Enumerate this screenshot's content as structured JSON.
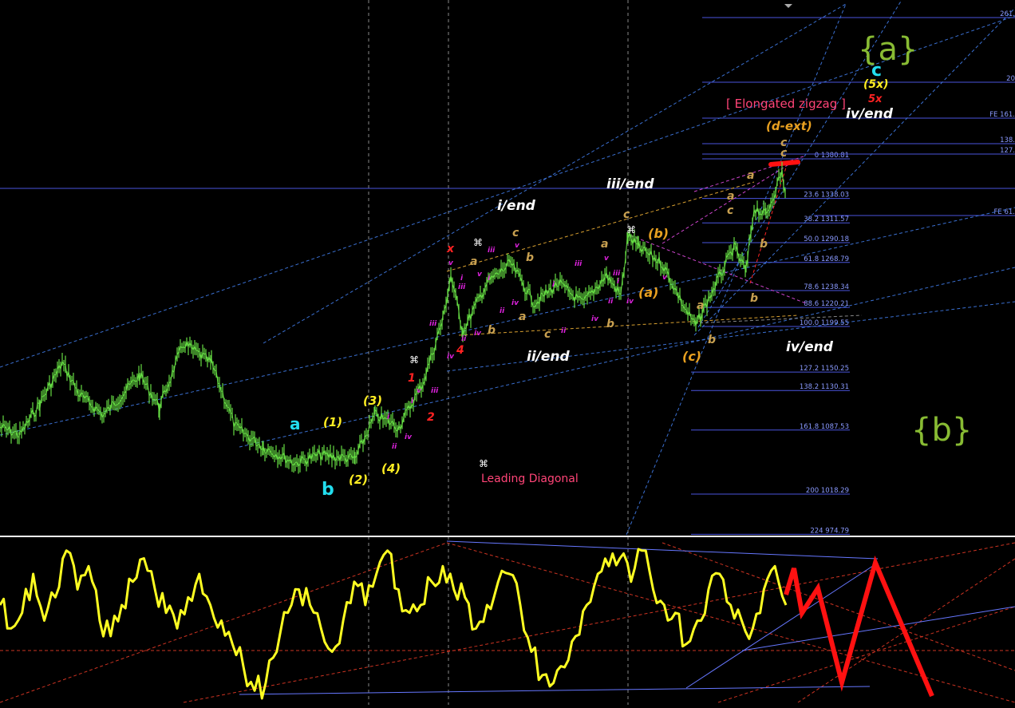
{
  "colors": {
    "background": "#000000",
    "price": "#66dd44",
    "oscillator": "#ffff22",
    "projection": "#ff1111",
    "fib_line": "#4a55dd",
    "channel": "#3a6fd0",
    "separator": "#ffffff"
  },
  "chart_data": [
    {
      "type": "line",
      "panel": "price",
      "fib_levels": [
        {
          "ratio": "0",
          "price": "1380.81",
          "label": "0 1380.81"
        },
        {
          "ratio": "23.6",
          "price": "1338.03",
          "label": "23.6 1338.03"
        },
        {
          "ratio": "38.2",
          "price": "1311.57",
          "label": "38.2 1311.57"
        },
        {
          "ratio": "50.0",
          "price": "1290.18",
          "label": "50.0 1290.18"
        },
        {
          "ratio": "61.8",
          "price": "1268.79",
          "label": "61.8 1268.79"
        },
        {
          "ratio": "78.6",
          "price": "1238.34",
          "label": "78.6 1238.34"
        },
        {
          "ratio": "88.6",
          "price": "1220.21",
          "label": "88.6 1220.21"
        },
        {
          "ratio": "100.0",
          "price": "1199.55",
          "label": "100.0 1199.55"
        },
        {
          "ratio": "127.2",
          "price": "1150.25",
          "label": "127.2 1150.25"
        },
        {
          "ratio": "138.2",
          "price": "1130.31",
          "label": "138.2 1130.31"
        },
        {
          "ratio": "161.8",
          "price": "1087.53",
          "label": "161.8 1087.53"
        },
        {
          "ratio": "200",
          "price": "1018.29",
          "label": "200 1018.29"
        },
        {
          "ratio": "224",
          "price": "974.79",
          "label": "224 974.79"
        }
      ],
      "fib_extension_labels": [
        "261.",
        "20",
        "FE 161.",
        "138.",
        "127.",
        "FE 61."
      ],
      "labels": {
        "big_a": "{a}",
        "big_b": "{b}",
        "elongated_zigzag": "[ Elongated zigzag ]",
        "leading_diagonal": "Leading Diagonal",
        "i_end": "i/end",
        "ii_end": "ii/end",
        "iii_end": "iii/end",
        "iv_end_upper": "iv/end",
        "iv_end_lower": "iv/end",
        "d_ext": "(d-ext)",
        "five_x_paren": "(5x)",
        "five_x": "5x",
        "c_cyan": "c",
        "a_cyan": "a",
        "b_cyan": "b",
        "w1": "(1)",
        "w2": "(2)",
        "w3": "(3)",
        "w4": "(4)",
        "paren_a": "(a)",
        "paren_b": "(b)",
        "paren_c": "(c)",
        "red_x": "x",
        "red_1": "1",
        "red_2": "2",
        "red_4": "4",
        "cmd": "⌘"
      },
      "small_labels": [
        {
          "text": "iii",
          "color": "#dd22dd"
        },
        {
          "text": "i",
          "color": "#dd22dd"
        },
        {
          "text": "v",
          "color": "#dd22dd"
        },
        {
          "text": "ii",
          "color": "#dd22dd"
        },
        {
          "text": "iv",
          "color": "#dd22dd"
        },
        {
          "text": "a",
          "color": "#c8a050"
        },
        {
          "text": "b",
          "color": "#c8a050"
        },
        {
          "text": "c",
          "color": "#c8a050"
        }
      ]
    },
    {
      "type": "line",
      "panel": "oscillator",
      "series": [
        {
          "values": [
            60,
            45,
            55,
            80,
            50,
            65,
            95,
            70,
            85,
            50,
            40,
            60,
            75,
            90,
            70,
            55,
            45,
            65,
            80,
            60,
            50,
            35,
            20,
            5,
            10,
            30,
            55,
            70,
            60,
            45,
            30,
            50,
            75,
            60,
            80,
            95,
            70,
            55,
            60,
            75,
            85,
            70,
            65,
            45,
            60,
            75,
            80,
            60,
            30,
            15,
            10,
            20,
            40,
            60,
            80,
            85,
            90,
            75,
            95,
            70,
            60,
            55,
            35,
            50,
            70,
            80,
            60,
            50,
            45,
            70,
            85,
            60
          ]
        }
      ]
    }
  ]
}
